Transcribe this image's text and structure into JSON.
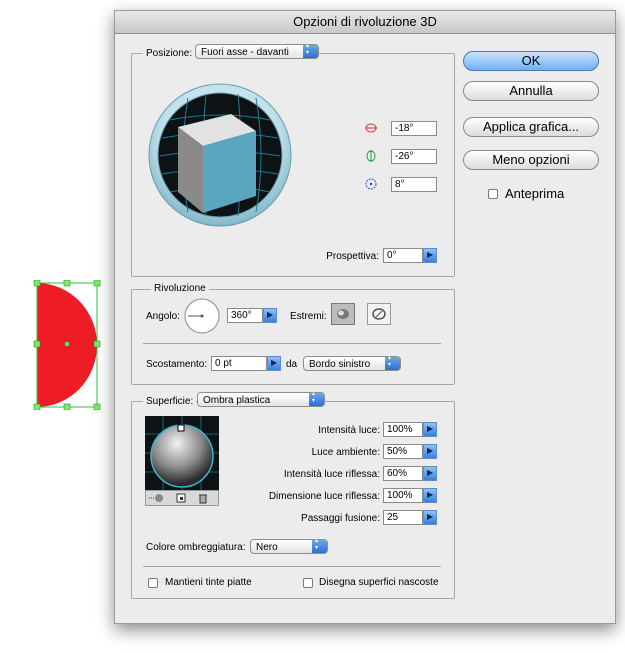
{
  "dialog": {
    "title": "Opzioni di rivoluzione 3D"
  },
  "position": {
    "label": "Posizione:",
    "value": "Fuori asse - davanti",
    "rot_x": "-18°",
    "rot_y": "-26°",
    "rot_z": "8°",
    "perspective_label": "Prospettiva:",
    "perspective_value": "0°"
  },
  "revolve": {
    "title": "Rivoluzione",
    "angle_label": "Angolo:",
    "angle_value": "360°",
    "cap_label": "Estremi:",
    "offset_label": "Scostamento:",
    "offset_value": "0 pt",
    "from_label": "da",
    "from_value": "Bordo sinistro"
  },
  "surface": {
    "label": "Superficie:",
    "value": "Ombra plastica",
    "light_intensity_label": "Intensità luce:",
    "light_intensity": "100%",
    "ambient_label": "Luce ambiente:",
    "ambient": "50%",
    "highlight_intensity_label": "Intensità luce riflessa:",
    "highlight_intensity": "60%",
    "highlight_size_label": "Dimensione luce riflessa:",
    "highlight_size": "100%",
    "blend_steps_label": "Passaggi fusione:",
    "blend_steps": "25",
    "shading_color_label": "Colore ombreggiatura:",
    "shading_color": "Nero",
    "preserve_spot_label": "Mantieni tinte piatte",
    "draw_hidden_label": "Disegna superfici nascoste"
  },
  "buttons": {
    "ok": "OK",
    "cancel": "Annulla",
    "map_art": "Applica grafica...",
    "fewer_options": "Meno opzioni",
    "preview": "Anteprima"
  },
  "colors": {
    "accent": "#3a7fdc",
    "cube_front": "#5aa6bf",
    "shape_fill": "#ee1c25"
  }
}
